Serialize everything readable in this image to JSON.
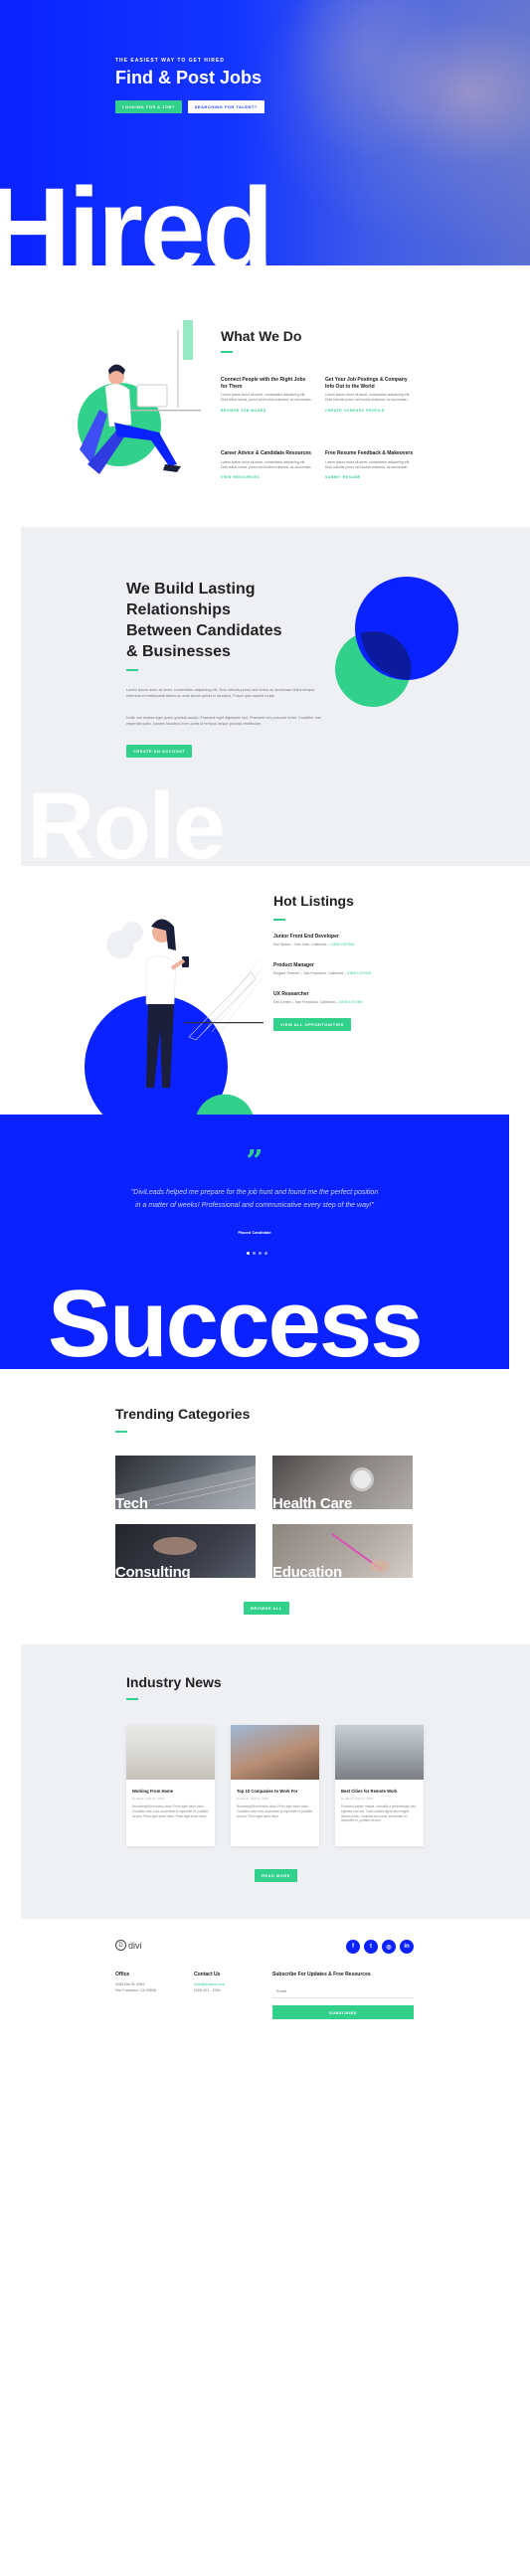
{
  "hero": {
    "eyebrow": "THE EASIEST WAY TO GET HIRED",
    "title": "Find & Post Jobs",
    "btn_primary": "LOOKING FOR A JOB?",
    "btn_secondary": "SEARCHING FOR TALENT?",
    "big_text": "Hired"
  },
  "what_we_do": {
    "title": "What We Do",
    "features": [
      {
        "title": "Connect People with the Right Jobs for Them",
        "text": "Lorem ipsum dolor sit amet, consectetur adipiscing elit. Duis tellus luctus, purus sed luctus euismod, ac accumsan.",
        "link": "BROWSE JOB BOARD"
      },
      {
        "title": "Get Your Job Postings & Company Info Out to the World",
        "text": "Lorem ipsum dolor sit amet, consectetur adipiscing elit. Duis lobortis purus sed luctus euismod, ac accumsan.",
        "link": "CREATE COMPANY PROFILE"
      },
      {
        "title": "Career Advice & Candidate Resources",
        "text": "Lorem ipsum dolor sit amet, consectetur adipiscing elit. Duis tellus luctus, purus sed luctus euismod, ac accumsan.",
        "link": "VIEW RESOURCES"
      },
      {
        "title": "Free Resume Feedback & Makeovers",
        "text": "Lorem ipsum dolor sit amet, consectetur adipiscing elit. Duis lobortis purus sed luctus euismod, ac accumsan.",
        "link": "SUBMIT RESUME"
      }
    ]
  },
  "build": {
    "title_lines": [
      "We Build Lasting",
      "Relationships",
      "Between Candidates",
      "& Businesses"
    ],
    "para1": "Lorem ipsum dolor sit amet, consectetur adipiscing elit. Duis lobortis purus sed luctus ac accumsan tellus tempor. Interdum et malesuada fames ac ante ipsum primis in faucibus. Fusce quis mauris turpis.",
    "para2": "Nulla non massa eget quam gravida auctor. Praesent eget dignissim orci. Praesent nec posuere tortor. Curabitur nisi imperdiet justo, lobortis faucibus enim porta id tempus neque gravida vestibulum.",
    "button": "CREATE AN ACCOUNT",
    "big_text": "Role"
  },
  "hot_listings": {
    "title": "Hot Listings",
    "jobs": [
      {
        "title": "Junior Front End Developer",
        "meta": "Divi Space – San Jose, California –",
        "link": "VIEW LISTING"
      },
      {
        "title": "Product Manager",
        "meta": "Elegant Themes – San Francisco, California –",
        "link": "VIEW LISTING"
      },
      {
        "title": "UX Researcher",
        "meta": "Divi Center – San Francisco, California –",
        "link": "VIEW LISTING"
      }
    ],
    "button": "VIEW ALL OPPORTUNITIES"
  },
  "testimonial": {
    "quote_mark": "”",
    "text": "\"DiviLeads helped me prepare for the job hunt and found me the perfect position in a matter of weeks! Professional and communicative every step of the way!\"",
    "name": "Placed Candidate",
    "big_text": "Success"
  },
  "trending": {
    "title": "Trending Categories",
    "categories": [
      {
        "label": "Tech"
      },
      {
        "label": "Health Care"
      },
      {
        "label": "Consulting"
      },
      {
        "label": "Education"
      }
    ],
    "button": "BROWSE ALL"
  },
  "news": {
    "title": "Industry News",
    "cards": [
      {
        "title": "Working From Home",
        "date": "by admin | Feb 11, 2019",
        "text": "Nonummy/Mum lectus dolor. Proin eget tortor risus. Curabitur arcu erat, accumsan id imperdiet et, porttitor at sem. Proin eget tortor risus. Proin eget tortor risus."
      },
      {
        "title": "Top 10 Companies to Work For",
        "date": "by admin | Feb 11, 2019",
        "text": "Nonummy/Mum lectus dolor. Proin eget tortor risus. Curabitur arcu erat, accumsan id imperdiet et, porttitor at sem. Proin eget tortor risus."
      },
      {
        "title": "Best Cities for Remote Work",
        "date": "by admin | Feb 11, 2019",
        "text": "Praesent sapien massa, convallis a pellentesque nec, egestas non nisi. Cras ultricies ligula sed magna dictum porta. Curabitur arcu erat, accumsan id imperdiet et, porttitor at sem."
      }
    ],
    "button": "READ MORE"
  },
  "footer": {
    "logo": "divi",
    "office_title": "Office",
    "office_lines": [
      "2085 Divi St. #983",
      "San Francisco, CA 93658"
    ],
    "contact_title": "Contact Us",
    "contact_email": "hello@divijobs.com",
    "contact_phone": "(245) 621 - 3364",
    "subscribe_title": "Subscribe For Updates & Free Resources",
    "email_placeholder": "Email",
    "subscribe_button": "SUBSCRIBE",
    "social": [
      "f",
      "t",
      "◎",
      "in"
    ]
  },
  "colors": {
    "brand_blue": "#0a22ff",
    "accent_green": "#31d08b",
    "light_gray": "#eef0f4"
  }
}
